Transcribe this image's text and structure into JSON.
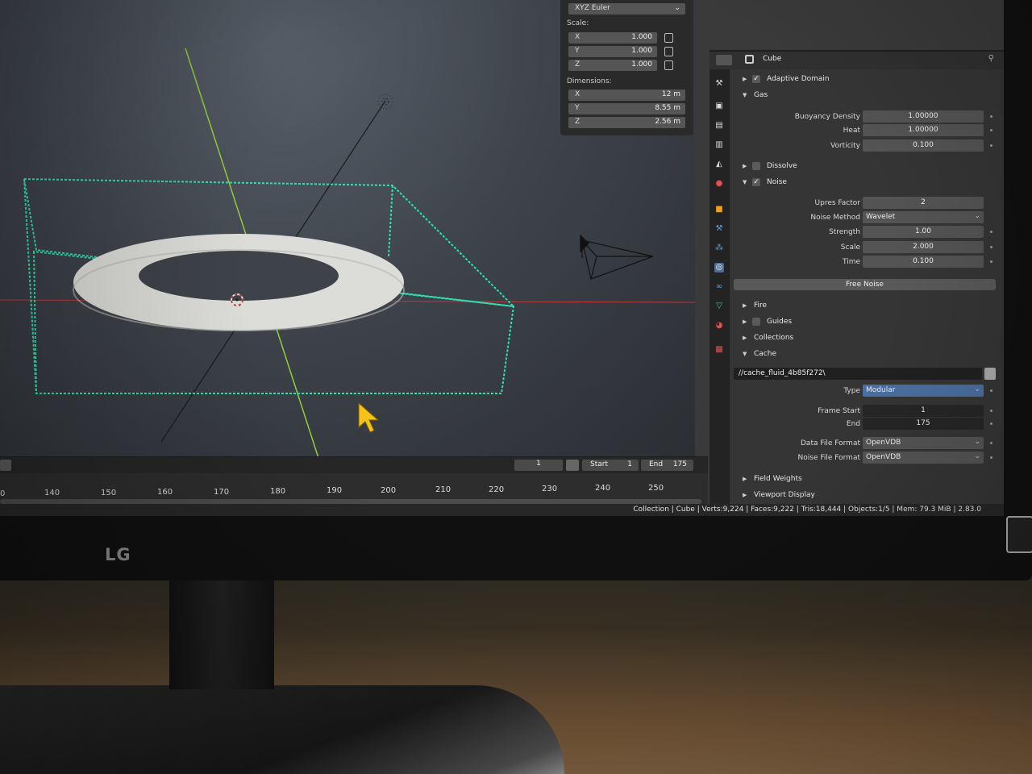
{
  "monitor": {
    "brand": "LG"
  },
  "n_panel": {
    "rotation_mode": "XYZ Euler",
    "scale_label": "Scale:",
    "scale": [
      {
        "axis": "X",
        "value": "1.000"
      },
      {
        "axis": "Y",
        "value": "1.000"
      },
      {
        "axis": "Z",
        "value": "1.000"
      }
    ],
    "dimensions_label": "Dimensions:",
    "dimensions": [
      {
        "axis": "X",
        "value": "12 m"
      },
      {
        "axis": "Y",
        "value": "8.55 m"
      },
      {
        "axis": "Z",
        "value": "2.56 m"
      }
    ]
  },
  "timeline": {
    "current_frame": "1",
    "start_label": "Start",
    "start_value": "1",
    "end_label": "End",
    "end_value": "175",
    "ticks": [
      "0",
      "140",
      "150",
      "160",
      "170",
      "180",
      "190",
      "200",
      "210",
      "220",
      "230",
      "240",
      "250"
    ]
  },
  "status_bar": "Collection | Cube | Verts:9,224 | Faces:9,222 | Tris:18,444 | Objects:1/5 | Mem: 79.3 MiB | 2.83.0",
  "properties": {
    "object_name": "Cube",
    "sections": {
      "adaptive_domain": "Adaptive Domain",
      "gas": "Gas",
      "dissolve": "Dissolve",
      "noise": "Noise",
      "fire": "Fire",
      "guides": "Guides",
      "collections": "Collections",
      "cache": "Cache",
      "field_weights": "Field Weights",
      "viewport_display": "Viewport Display"
    },
    "gas": {
      "buoyancy_density_label": "Buoyancy Density",
      "buoyancy_density": "1.00000",
      "heat_label": "Heat",
      "heat": "1.00000",
      "vorticity_label": "Vorticity",
      "vorticity": "0.100"
    },
    "noise": {
      "upres_label": "Upres Factor",
      "upres": "2",
      "method_label": "Noise Method",
      "method": "Wavelet",
      "strength_label": "Strength",
      "strength": "1.00",
      "scale_label": "Scale",
      "scale": "2.000",
      "time_label": "Time",
      "time": "0.100",
      "free_button": "Free Noise"
    },
    "cache": {
      "path": "//cache_fluid_4b85f272\\",
      "type_label": "Type",
      "type": "Modular",
      "frame_start_label": "Frame Start",
      "frame_start": "1",
      "end_label": "End",
      "end": "175",
      "data_format_label": "Data File Format",
      "data_format": "OpenVDB",
      "noise_format_label": "Noise File Format",
      "noise_format": "OpenVDB"
    }
  },
  "colors": {
    "domain_wire": "#2fe0b0",
    "x_axis": "#c0393b",
    "y_axis": "#8fcf3c",
    "cursor": "#f4c21a"
  }
}
